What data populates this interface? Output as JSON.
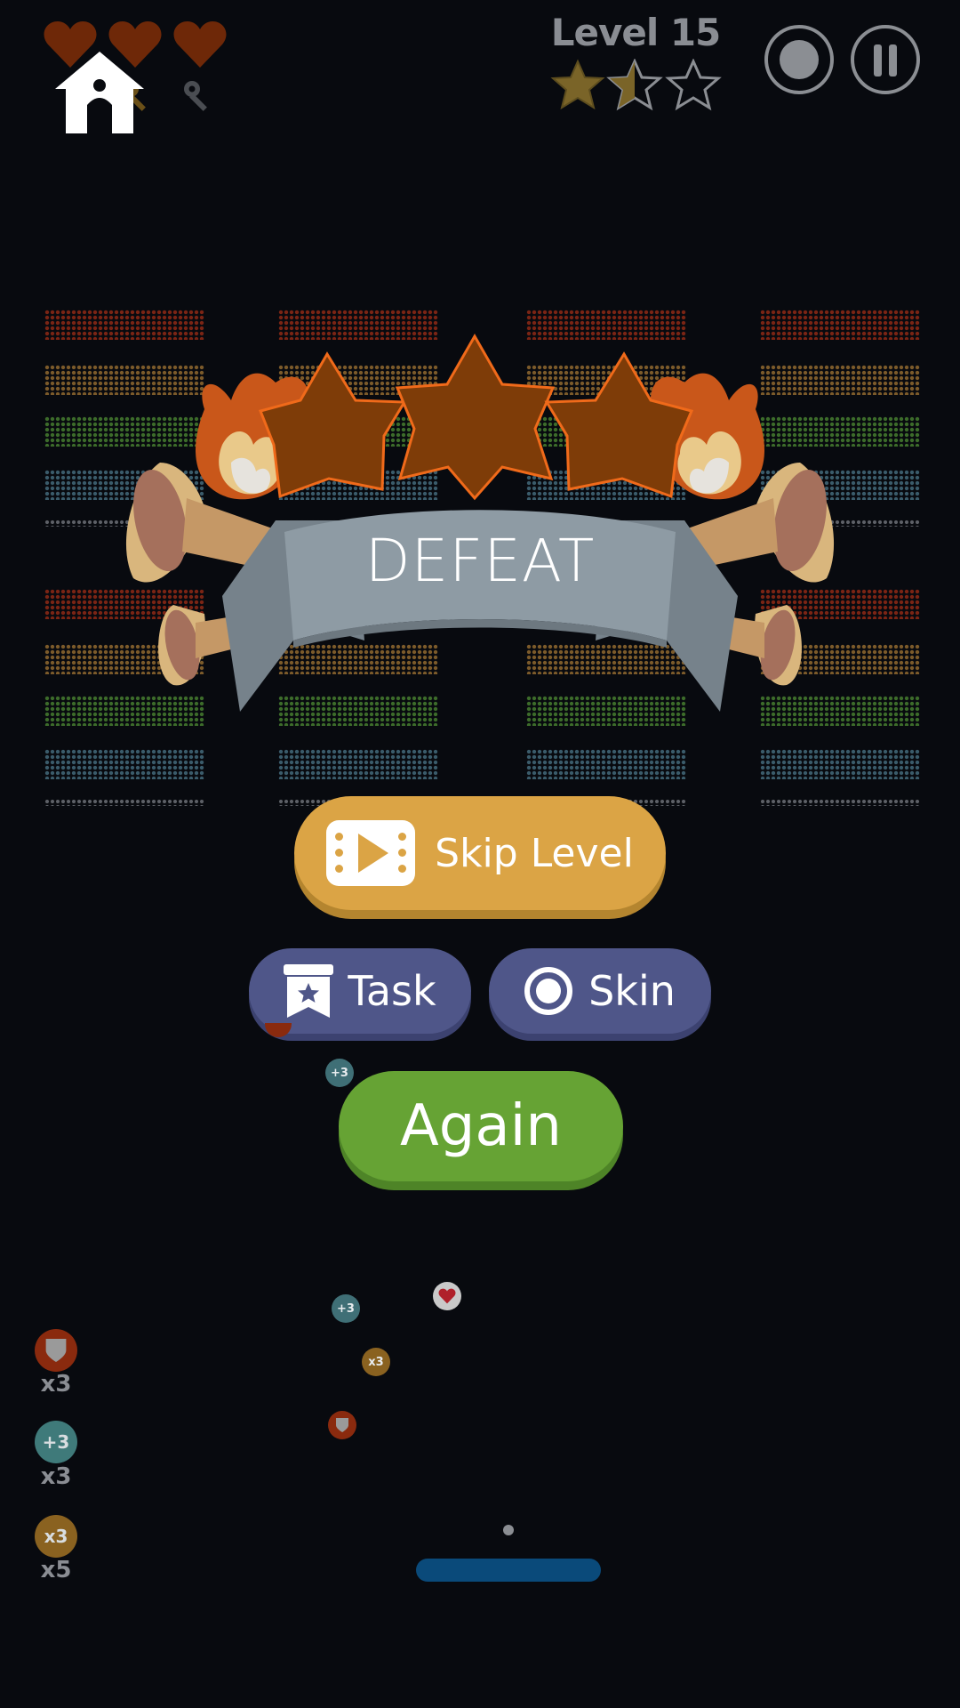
{
  "hud": {
    "lives": 3,
    "level_label": "Level 15",
    "stars_earned": 1.5,
    "stars_total": 3,
    "colors": {
      "heart": "#7a2a08",
      "star_filled": "#7a6428",
      "hud_gray": "#8b8e93"
    }
  },
  "banner": {
    "title": "DEFEAT",
    "colors": {
      "ribbon": "#8e9ba4",
      "star": "#7e3c08",
      "star_outline": "#f06a1a"
    }
  },
  "buttons": {
    "skip_label": "Skip Level",
    "task_label": "Task",
    "skin_label": "Skin",
    "again_label": "Again"
  },
  "powerups": [
    {
      "icon": "shield-icon",
      "count": "x3",
      "color": "#8a2a0e"
    },
    {
      "badge": "+3",
      "count": "x3",
      "color": "#3f7a7a"
    },
    {
      "badge": "x3",
      "count": "x5",
      "color": "#8a6220"
    }
  ],
  "field_orbs": [
    {
      "badge": "+3",
      "color": "#3f6f76"
    },
    {
      "badge": "+3",
      "color": "#3f6f76"
    },
    {
      "badge": "x3",
      "color": "#8a6220"
    },
    {
      "icon": "heart-icon",
      "color": "#c9c9c9"
    },
    {
      "icon": "shield-icon",
      "color": "#8a2a0e"
    }
  ],
  "brick_colors": [
    "#7a2414",
    "#7b5a2a",
    "#3c6b2a",
    "#3a5b6a"
  ]
}
